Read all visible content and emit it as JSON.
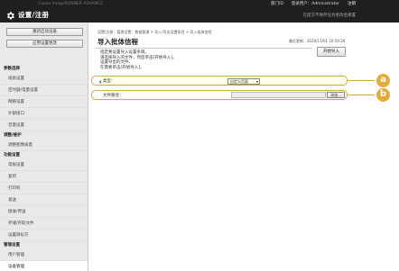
{
  "topbar": {
    "device": "Canon imageRUNNER ADVANCE",
    "links": [
      "部门ID",
      "登录用户：Administrator",
      "注销"
    ]
  },
  "header": {
    "title": "设置/注册",
    "subtitle": "在提交不保存任务更改后重置"
  },
  "sidebar": {
    "buttons": [
      "重新启动设备",
      "应用设置更改"
    ],
    "nav": [
      {
        "kind": "grp",
        "label": "参数选择"
      },
      {
        "kind": "itm",
        "label": "纸张设置"
      },
      {
        "kind": "itm",
        "label": "定时器/电量设置"
      },
      {
        "kind": "itm",
        "label": "网络设置"
      },
      {
        "kind": "itm",
        "label": "外部接口"
      },
      {
        "kind": "itm",
        "label": "音量设置"
      },
      {
        "kind": "grp",
        "label": "调整/维护"
      },
      {
        "kind": "itm",
        "label": "调整图像质量"
      },
      {
        "kind": "grp",
        "label": "功能设置"
      },
      {
        "kind": "itm",
        "label": "常规设置"
      },
      {
        "kind": "itm",
        "label": "复印"
      },
      {
        "kind": "itm",
        "label": "打印机"
      },
      {
        "kind": "itm",
        "label": "发送"
      },
      {
        "kind": "itm",
        "label": "接收/传送"
      },
      {
        "kind": "itm",
        "label": "存储/存取文件"
      },
      {
        "kind": "itm",
        "label": "设置目标方"
      },
      {
        "kind": "grp",
        "label": "管理设置"
      },
      {
        "kind": "itm",
        "label": "用户管理"
      },
      {
        "kind": "itm",
        "label": "设备管理",
        "sel": true
      }
    ]
  },
  "main": {
    "breadcrumb": "设置/注册：管理设置：数据管理 > 导入/导出设置条目 > 导入组体信程",
    "title": "导入批体信程",
    "updated": "最近更新：2020/11/01 10:59:26",
    "start_label": "开始导入",
    "description": [
      "指定要设置导入设置条目。",
      "请选择导入的文件，然后单击[开始导入]。",
      "设置导出的文件。",
      "在需要单击[开始导入]。"
    ],
    "type_label": "类型：",
    "type_value": "自定义页面",
    "file_label": "文件路径：",
    "browse_label": "浏览..."
  },
  "badges": [
    "a",
    "b"
  ],
  "colors": {
    "accent": "#e5ab37",
    "header_bg": "#1f1f1f"
  }
}
